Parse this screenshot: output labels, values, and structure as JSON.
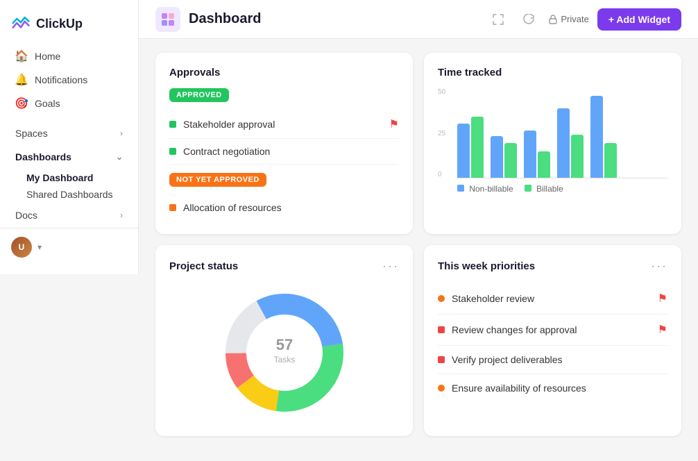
{
  "app": {
    "name": "ClickUp"
  },
  "sidebar": {
    "nav_items": [
      {
        "id": "home",
        "label": "Home",
        "icon": "🏠"
      },
      {
        "id": "notifications",
        "label": "Notifications",
        "icon": "🔔"
      },
      {
        "id": "goals",
        "label": "Goals",
        "icon": "🎯"
      }
    ],
    "sections": [
      {
        "id": "spaces",
        "label": "Spaces",
        "expandable": true
      },
      {
        "id": "dashboards",
        "label": "Dashboards",
        "expandable": true,
        "active": true
      },
      {
        "id": "docs",
        "label": "Docs",
        "expandable": true
      }
    ],
    "sub_items": [
      {
        "id": "my-dashboard",
        "label": "My Dashboard",
        "active": true
      },
      {
        "id": "shared-dashboards",
        "label": "Shared Dashboards"
      }
    ]
  },
  "header": {
    "title": "Dashboard",
    "icon": "⊞",
    "private_label": "Private",
    "add_widget_label": "+ Add Widget"
  },
  "approvals_widget": {
    "title": "Approvals",
    "approved_badge": "APPROVED",
    "not_approved_badge": "NOT YET APPROVED",
    "approved_items": [
      {
        "text": "Stakeholder approval",
        "flagged": true
      },
      {
        "text": "Contract negotiation",
        "flagged": false
      }
    ],
    "not_approved_items": [
      {
        "text": "Allocation of resources",
        "flagged": false
      }
    ]
  },
  "time_tracked_widget": {
    "title": "Time tracked",
    "y_labels": [
      "50",
      "25",
      "0"
    ],
    "bars": [
      {
        "non_billable": 60,
        "billable": 70
      },
      {
        "non_billable": 50,
        "billable": 40
      },
      {
        "non_billable": 55,
        "billable": 30
      },
      {
        "non_billable": 80,
        "billable": 50
      },
      {
        "non_billable": 100,
        "billable": 40
      }
    ],
    "legend_non_billable": "Non-billable",
    "legend_billable": "Billable"
  },
  "project_status_widget": {
    "title": "Project status",
    "task_count": "57",
    "task_label": "Tasks"
  },
  "priorities_widget": {
    "title": "This week priorities",
    "items": [
      {
        "text": "Stakeholder review",
        "dot_type": "orange-circle",
        "flagged": true
      },
      {
        "text": "Review changes for approval",
        "dot_type": "red-square",
        "flagged": true
      },
      {
        "text": "Verify project deliverables",
        "dot_type": "red-square",
        "flagged": false
      },
      {
        "text": "Ensure availability of resources",
        "dot_type": "orange-circle",
        "flagged": false
      }
    ]
  }
}
